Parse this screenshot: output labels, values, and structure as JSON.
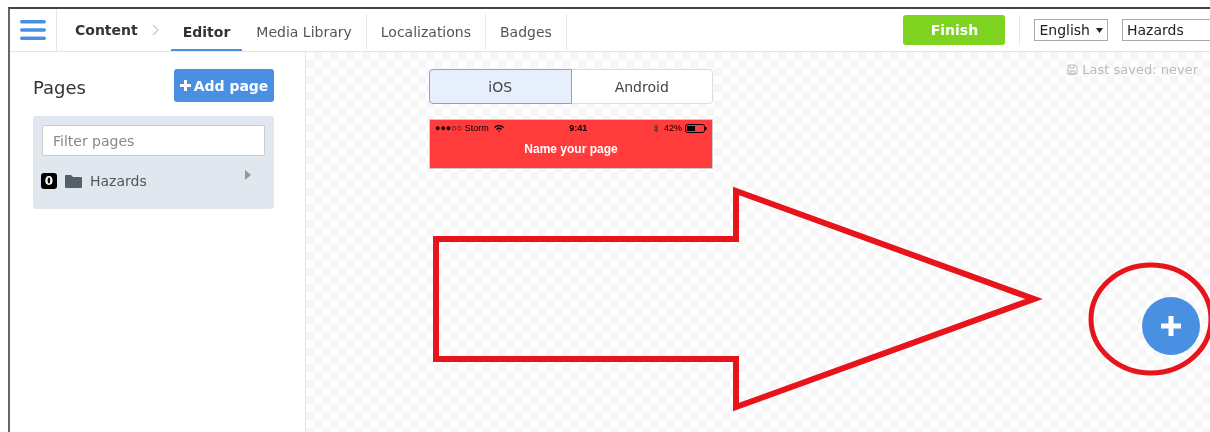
{
  "nav": {
    "breadcrumb": "Content",
    "tabs": [
      {
        "label": "Editor",
        "selected": true
      },
      {
        "label": "Media Library",
        "selected": false
      },
      {
        "label": "Localizations",
        "selected": false
      },
      {
        "label": "Badges",
        "selected": false
      }
    ],
    "finish": "Finish",
    "language": "English",
    "app": "Hazards"
  },
  "sidebar": {
    "title": "Pages",
    "add_button": "Add page",
    "filter": {
      "placeholder": "Filter pages"
    },
    "items": [
      {
        "badge": "0",
        "label": "Hazards"
      }
    ]
  },
  "editor": {
    "platforms": [
      {
        "label": "iOS",
        "selected": true
      },
      {
        "label": "Android",
        "selected": false
      }
    ],
    "last_saved": "Last saved: never",
    "phone": {
      "carrier": "●●●○○ Storm",
      "time": "9:41",
      "battery": "42%",
      "title": "Name your page"
    }
  }
}
